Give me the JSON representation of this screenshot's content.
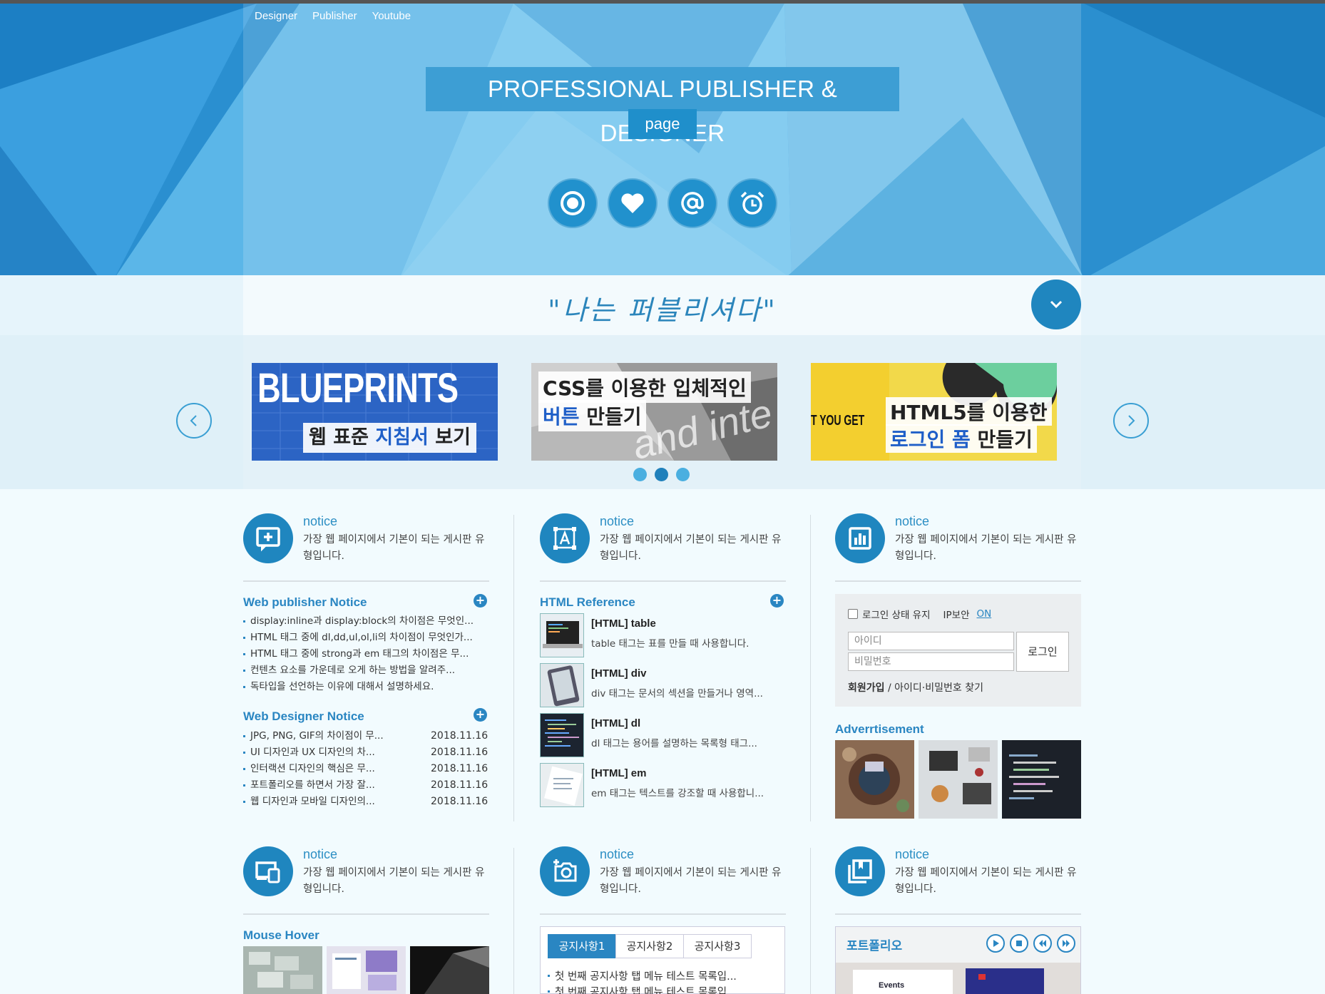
{
  "nav": {
    "items": [
      "Designer",
      "Publisher",
      "Youtube"
    ]
  },
  "hero": {
    "title": "PROFESSIONAL PUBLISHER & DESIGNER",
    "subtitle": "page",
    "icons": [
      "target-icon",
      "heart-icon",
      "at-icon",
      "alarm-clock-icon"
    ]
  },
  "slogan": {
    "text": "\"나는 퍼블리셔다\""
  },
  "slider": {
    "slides": [
      {
        "big": "BLUEPRINTS",
        "line1a": "웹 표준 ",
        "line1b": "지침서",
        "line1c": " 보기"
      },
      {
        "line1": "CSS를 이용한 입체적인",
        "line2a": "버튼",
        "line2b": " 만들기",
        "bg_text": "and inte"
      },
      {
        "line1": "HTML5를 이용한",
        "line2a": "로그인 폼",
        "line2b": " 만들기",
        "side": "T YOU GET"
      }
    ],
    "active_dot": 1
  },
  "notices": [
    {
      "title": "notice",
      "desc": "가장 웹 페이지에서 기본이 되는 게시판 유형입니다.",
      "icon": "add-comment-icon"
    },
    {
      "title": "notice",
      "desc": "가장 웹 페이지에서 기본이 되는 게시판 유형입니다.",
      "icon": "text-frame-icon"
    },
    {
      "title": "notice",
      "desc": "가장 웹 페이지에서 기본이 되는 게시판 유형입니다.",
      "icon": "bar-chart-icon"
    },
    {
      "title": "notice",
      "desc": "가장 웹 페이지에서 기본이 되는 게시판 유형입니다.",
      "icon": "devices-icon"
    },
    {
      "title": "notice",
      "desc": "가장 웹 페이지에서 기본이 되는 게시판 유형입니다.",
      "icon": "add-camera-icon"
    },
    {
      "title": "notice",
      "desc": "가장 웹 페이지에서 기본이 되는 게시판 유형입니다.",
      "icon": "gallery-icon"
    }
  ],
  "publisher_notice": {
    "title": "Web publisher Notice",
    "items": [
      "display:inline과 display:block의 차이점은 무엇인...",
      "HTML 태그 중에 dl,dd,ul,ol,li의 차이점이 무엇인가...",
      "HTML 태그 중에 strong과 em 태그의 차이점은 무...",
      "컨텐츠 요소를 가운데로 오게 하는 방법을 알려주...",
      "독타입을 선언하는 이유에 대해서 설명하세요."
    ]
  },
  "designer_notice": {
    "title": "Web Designer Notice",
    "items": [
      {
        "text": "JPG, PNG, GIF의 차이점이 무...",
        "date": "2018.11.16"
      },
      {
        "text": "UI 디자인과 UX 디자인의 차...",
        "date": "2018.11.16"
      },
      {
        "text": "인터랙션 디자인의 핵심은 무...",
        "date": "2018.11.16"
      },
      {
        "text": "포트폴리오를 하면서 가장 잘...",
        "date": "2018.11.16"
      },
      {
        "text": "웹 디자인과 모바일 디자인의...",
        "date": "2018.11.16"
      }
    ]
  },
  "html_reference": {
    "title": "HTML Reference",
    "items": [
      {
        "title": "[HTML] table",
        "desc": "table 태그는 표를 만들 때 사용합니다."
      },
      {
        "title": "[HTML] div",
        "desc": "div 태그는 문서의 섹션을 만들거나 영역..."
      },
      {
        "title": "[HTML] dl",
        "desc": "dl 태그는 용어를 설명하는 목록형 태그..."
      },
      {
        "title": "[HTML] em",
        "desc": "em 태그는 텍스트를 강조할 때 사용합니..."
      }
    ]
  },
  "login": {
    "keep_label": "로그인 상태 유지",
    "ip_label": "IP보안",
    "ip_state": "ON",
    "id_placeholder": "아이디",
    "pw_placeholder": "비밀번호",
    "login_button": "로그인",
    "signup": "회원가입",
    "separator": " / ",
    "find": "아이디·비밀번호 찾기"
  },
  "advertisement": {
    "title": "Adverrtisement"
  },
  "mouse_hover": {
    "title": "Mouse Hover"
  },
  "tabs": {
    "labels": [
      "공지사항1",
      "공지사항2",
      "공지사항3"
    ],
    "active": 0,
    "items": [
      "첫 번째 공지사항 탭 메뉴 테스트 목록입...",
      "첫 번째 공지사항 탭 메뉴 테스트 목록입..."
    ]
  },
  "portfolio": {
    "title": "포트폴리오",
    "preview_text": "Events",
    "controls": [
      "play-icon",
      "stop-icon",
      "prev-icon",
      "next-icon"
    ]
  },
  "colors": {
    "primary": "#2a86c2",
    "hero": "#3aa3dd",
    "dark_blue": "#1f86bf"
  }
}
